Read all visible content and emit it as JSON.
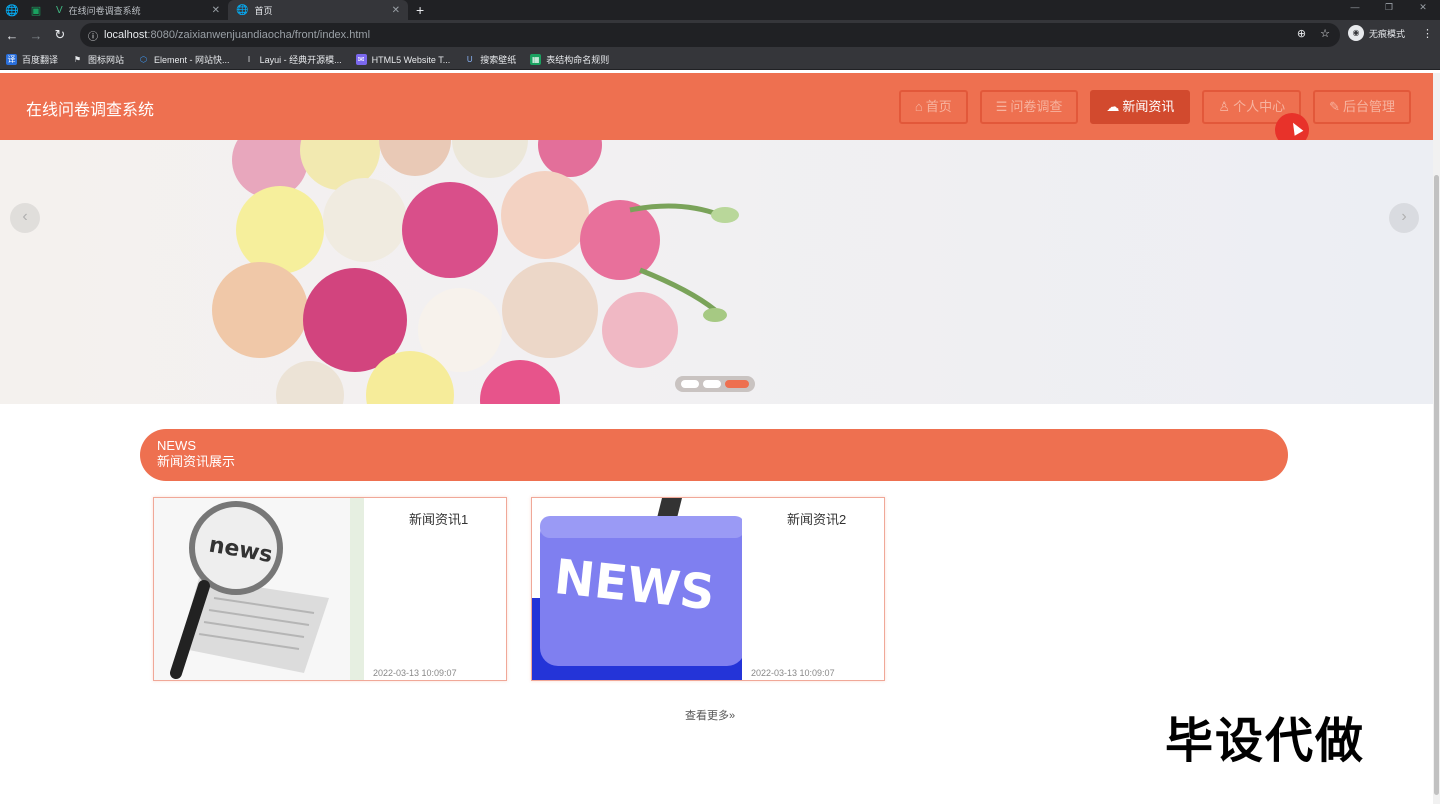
{
  "browser": {
    "tabs": [
      {
        "title": "在线问卷调查系统",
        "active": false
      },
      {
        "title": "首页",
        "active": true
      }
    ],
    "url_host": "localhost",
    "url_rest": ":8080/zaixianwenjuandiaocha/front/index.html",
    "incognito_label": "无痕模式",
    "bookmarks": [
      {
        "label": "百度翻译",
        "color": "#2a6fdb"
      },
      {
        "label": "图标网站",
        "color": "#111111"
      },
      {
        "label": "Element - 网站快...",
        "color": "#409eff"
      },
      {
        "label": "Layui - 经典开源模...",
        "color": "#444444"
      },
      {
        "label": "HTML5 Website T...",
        "color": "#7b68ee"
      },
      {
        "label": "搜索壁纸",
        "color": "#3b5bdb"
      },
      {
        "label": "表结构命名规则",
        "color": "#1aa260"
      }
    ]
  },
  "site": {
    "title": "在线问卷调查系统",
    "accent_color": "#ee7050",
    "nav": [
      {
        "label": "首页",
        "icon": "home-icon",
        "active": false
      },
      {
        "label": "问卷调查",
        "icon": "survey-icon",
        "active": false
      },
      {
        "label": "新闻资讯",
        "icon": "cloud-icon",
        "active": true
      },
      {
        "label": "个人中心",
        "icon": "user-icon",
        "active": false
      },
      {
        "label": "后台管理",
        "icon": "wrench-icon",
        "active": false
      }
    ]
  },
  "banner": {
    "slide_count": 3,
    "active_slide": 3
  },
  "news": {
    "heading_en": "NEWS",
    "heading_cn": "新闻资讯展示",
    "items": [
      {
        "title": "新闻资讯1",
        "date": "2022-03-13 10:09:07",
        "image": "magnifier-newspaper"
      },
      {
        "title": "新闻资讯2",
        "date": "2022-03-13 10:09:07",
        "image": "news-key"
      }
    ],
    "more_label": "查看更多",
    "more_icon": "double-chevron-right-icon"
  },
  "overlay": {
    "watermark": "毕设代做"
  }
}
